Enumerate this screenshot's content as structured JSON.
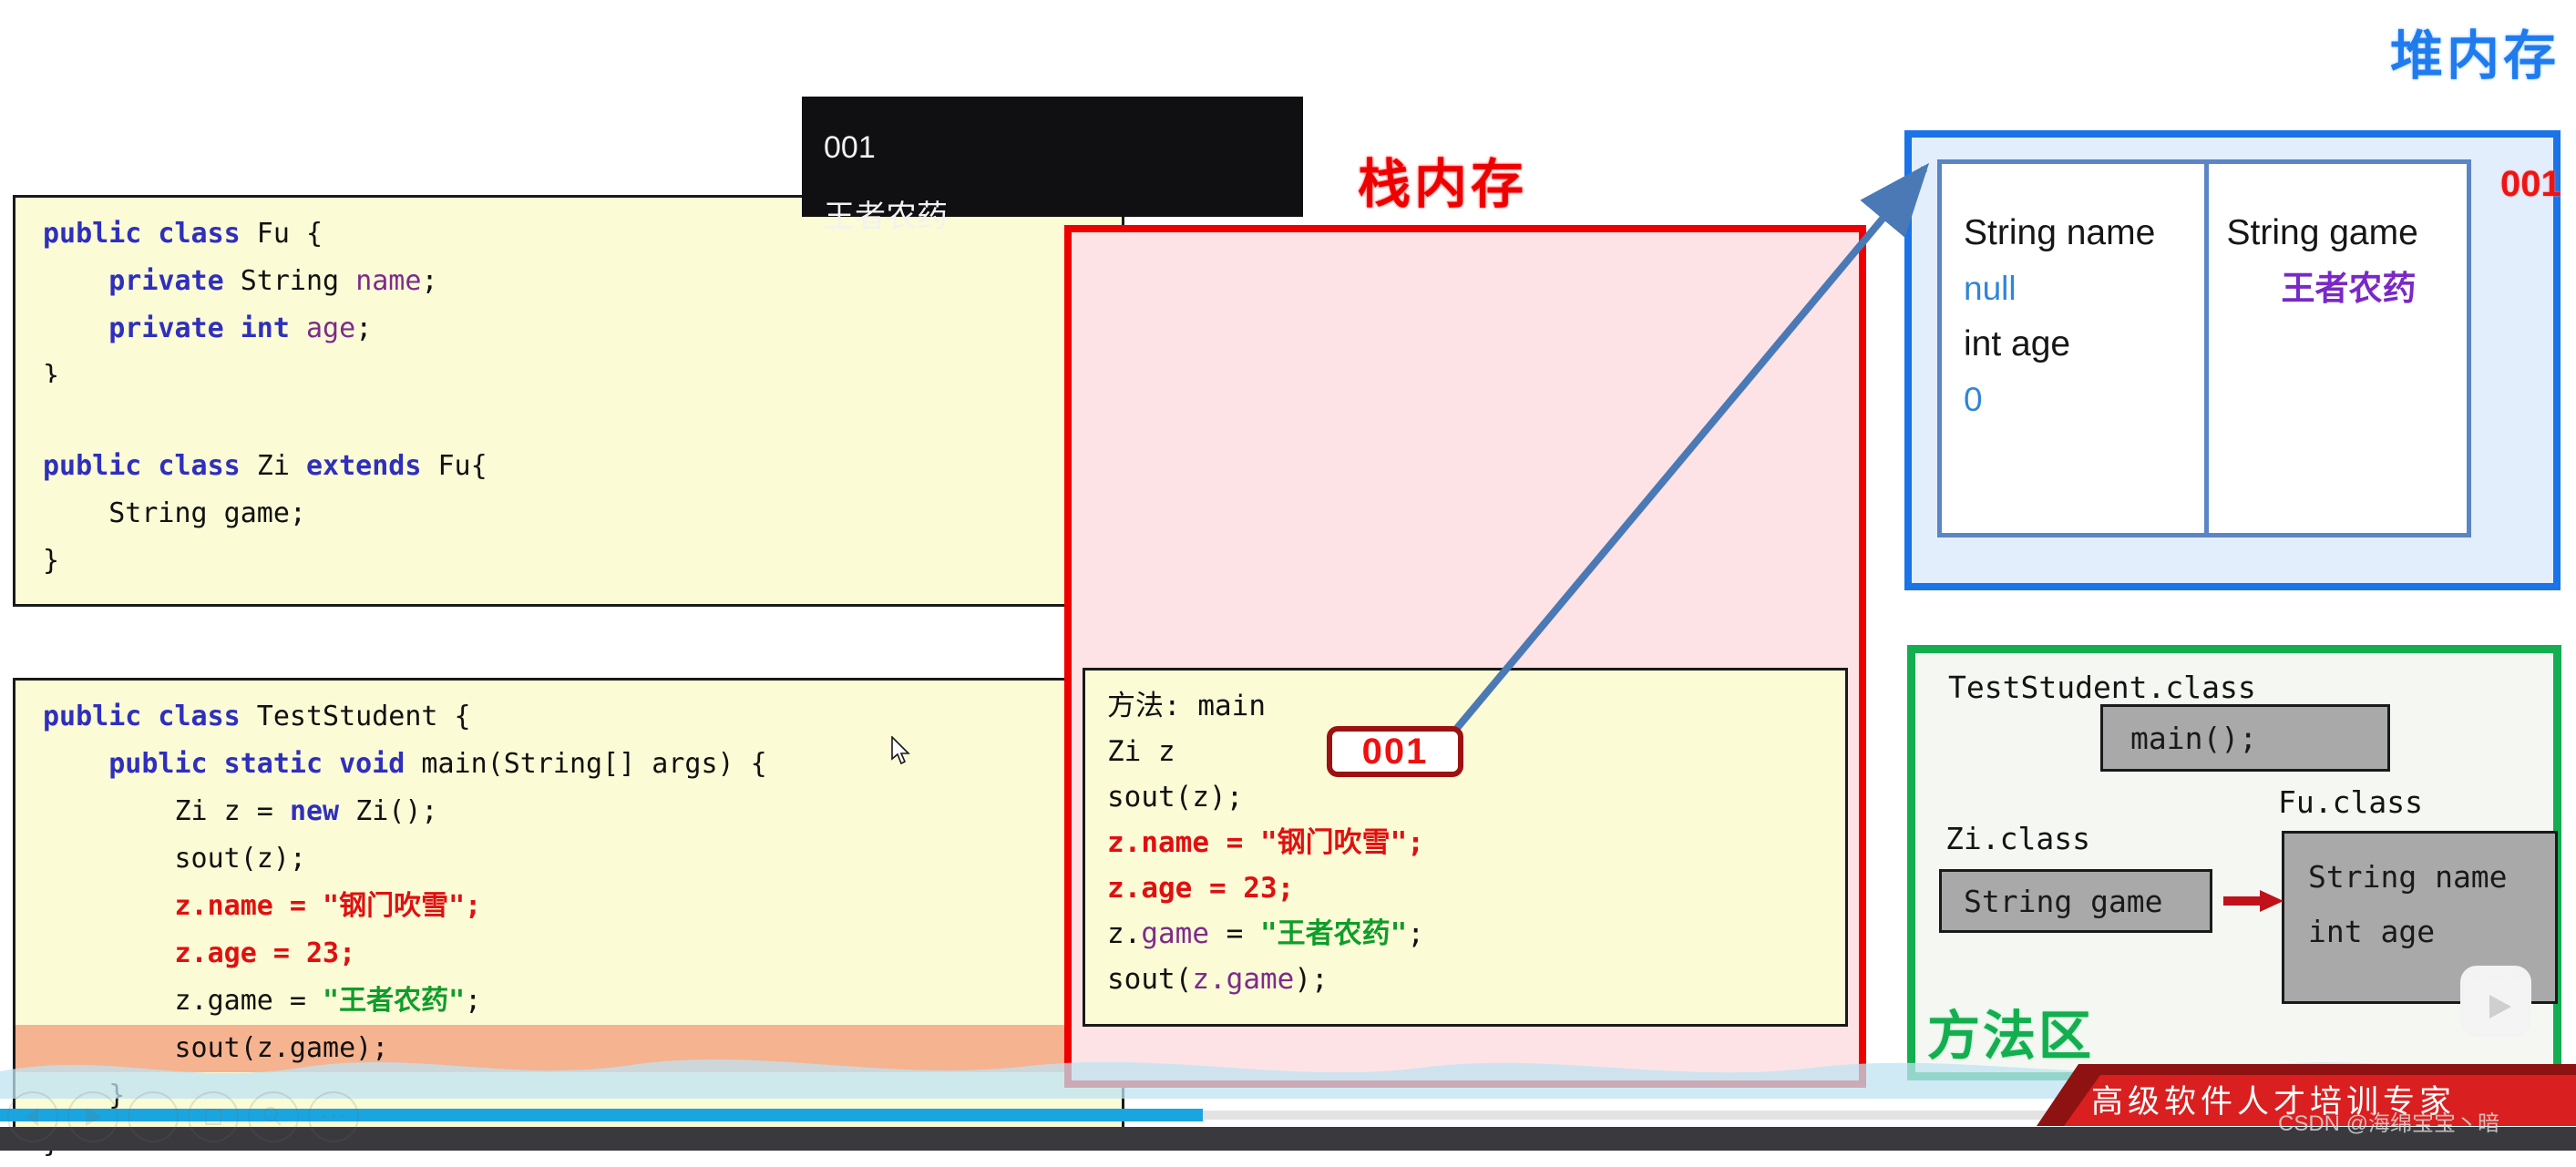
{
  "console_overlay": {
    "name": "program-output-console",
    "lines": [
      "001",
      "王者农药"
    ]
  },
  "code_panels": [
    {
      "name": "fu-zi-source",
      "lines": [
        "public class Fu {",
        "    private String name;",
        "    private int age;",
        "}",
        "",
        "public class Zi extends Fu{",
        "    String game;",
        "}"
      ]
    },
    {
      "name": "teststudent-source",
      "lines": [
        "public class TestStudent {",
        "    public static void main(String[] args) {",
        "        Zi z = new Zi();",
        "        sout(z);",
        "        z.name = \"钢门吹雪\";",
        "        z.age = 23;",
        "        z.game = \"王者农药\";",
        "        sout(z.game);",
        "    }",
        "}"
      ],
      "highlighted_line": "sout(z.game);"
    }
  ],
  "stack": {
    "title": "栈内存",
    "frame": {
      "method_label": "方法: main",
      "lines": [
        "方法: main",
        "Zi z",
        "sout(z);",
        "z.name = \"钢门吹雪\";",
        "z.age = 23;",
        "z.game = \"王者农药\";",
        "sout(z.game);"
      ]
    },
    "reference_badge": "001"
  },
  "heap": {
    "title": "堆内存",
    "object_id": "001",
    "cells": [
      {
        "field": "String name",
        "value": "null"
      },
      {
        "field": "String game",
        "value": "王者农药"
      }
    ],
    "extra_field": {
      "field": "int age",
      "value": "0"
    }
  },
  "method_area": {
    "region_label": "方法区",
    "classes": [
      {
        "title": "TestStudent.class",
        "members": [
          "main();"
        ]
      },
      {
        "title": "Zi.class",
        "members": [
          "String game"
        ]
      },
      {
        "title": "Fu.class",
        "members": [
          "String name",
          "int age"
        ]
      }
    ]
  },
  "player": {
    "brand_text": "高级软件人才培训专家",
    "watermark": "CSDN @海绵宝宝丶暗",
    "controls": [
      "prev-icon",
      "play-icon",
      "pen-icon",
      "stamp-icon",
      "search-icon",
      "more-icon"
    ]
  },
  "colors": {
    "stack_red": "#ee0000",
    "heap_blue": "#1a73e8",
    "method_green": "#13ae4f",
    "code_bg": "#fbfbd6",
    "highlight": "#f6b390",
    "accent_progress": "#19a6e0"
  }
}
